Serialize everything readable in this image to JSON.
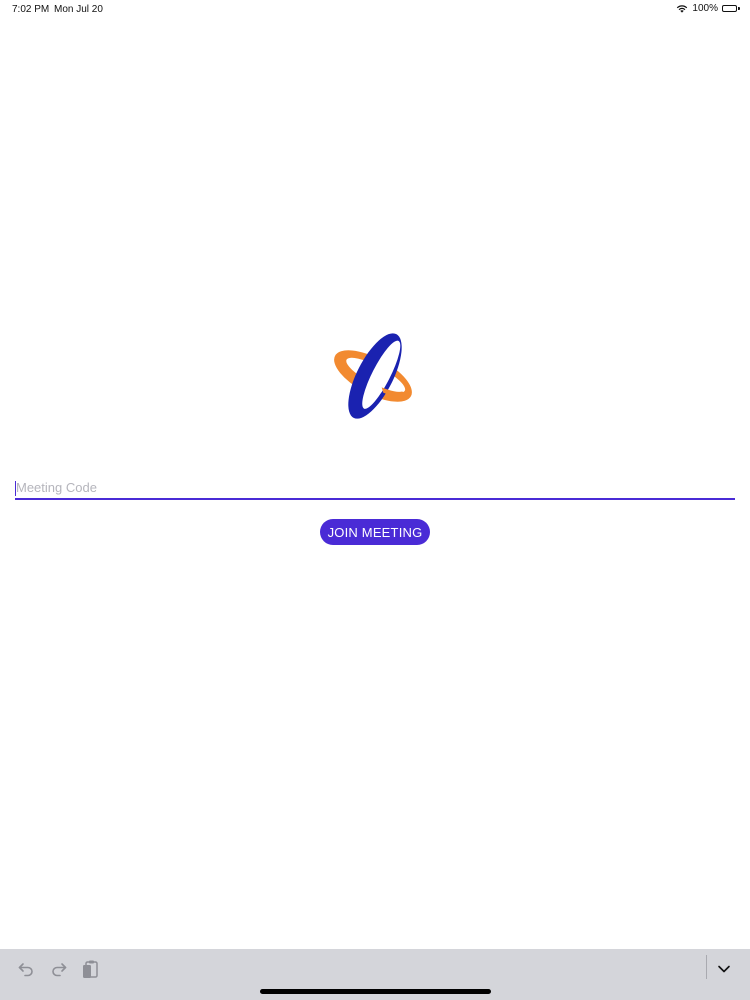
{
  "status_bar": {
    "time": "7:02 PM",
    "date": "Mon Jul 20",
    "battery": "100%",
    "battery_level": 1.0,
    "icons": [
      "wifi-icon",
      "battery-icon"
    ]
  },
  "logo": {
    "icon": "orbit-logo-icon",
    "colors": {
      "ring": "#1a22b0",
      "orbit": "#f28a30"
    }
  },
  "meeting_code": {
    "placeholder": "Meeting Code",
    "value": ""
  },
  "join_button": {
    "label": "JOIN MEETING"
  },
  "shortcut_bar": {
    "icons": [
      "undo-icon",
      "redo-icon",
      "paste-icon",
      "chevron-down-icon"
    ]
  },
  "colors": {
    "accent": "#4a2bd6",
    "bar_background": "#d4d5da",
    "placeholder": "#b5b5bc"
  }
}
